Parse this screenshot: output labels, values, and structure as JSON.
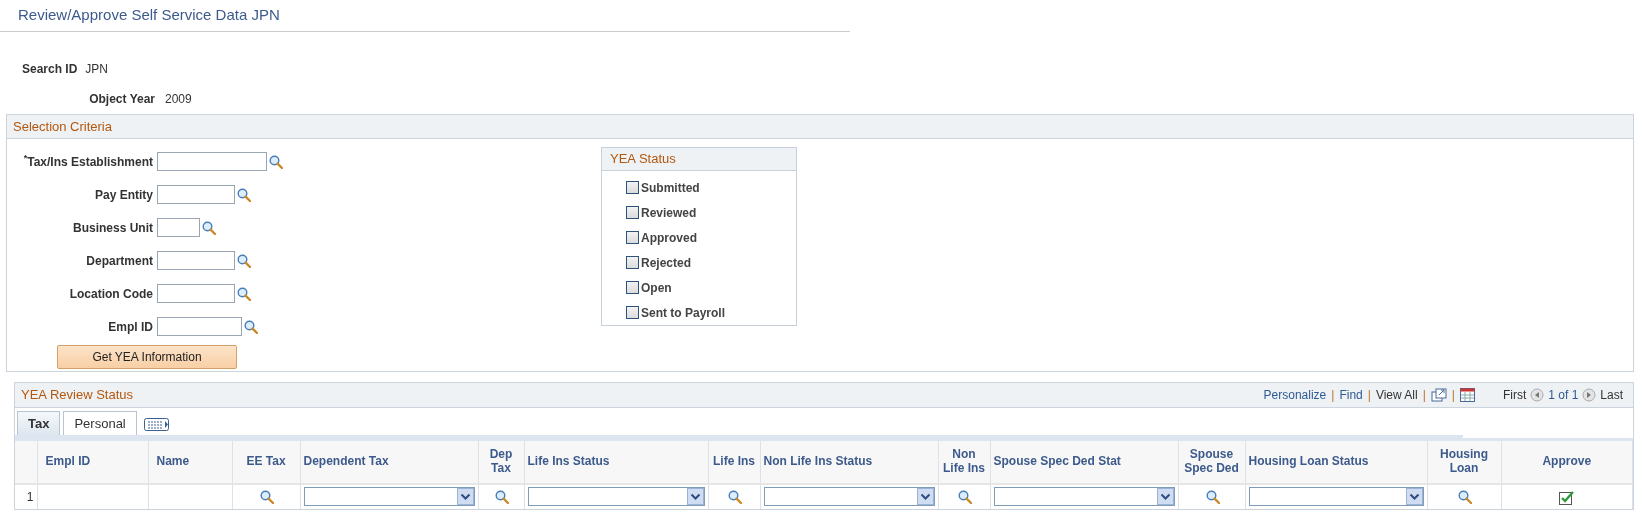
{
  "page_title": "Review/Approve Self Service Data JPN",
  "search_id": {
    "label": "Search ID",
    "value": "JPN"
  },
  "object_year": {
    "label": "Object Year",
    "value": "2009"
  },
  "selection_criteria": {
    "title": "Selection Criteria",
    "fields": [
      {
        "label": "$^{*}$Tax/Ins Establishment"
      },
      {
        "label": "Pay Entity"
      },
      {
        "label": "Business Unit"
      },
      {
        "label": "Department"
      },
      {
        "label": "Location Code"
      },
      {
        "label": "Empl ID"
      }
    ],
    "button": "Get YEA Information"
  },
  "yea_status": {
    "title": "YEA Status",
    "options": [
      {
        "label": "Submitted",
        "checked": false
      },
      {
        "label": "Reviewed",
        "checked": false
      },
      {
        "label": "Approved",
        "checked": false
      },
      {
        "label": "Rejected",
        "checked": false
      },
      {
        "label": "Open",
        "checked": false
      },
      {
        "label": "Sent to Payroll",
        "checked": false
      }
    ]
  },
  "review_status": {
    "title": "YEA Review Status",
    "toolbar": [
      {
        "kind": "link",
        "label": "Personalize"
      },
      {
        "kind": "separator",
        "label": "|"
      },
      {
        "kind": "link",
        "label": "Find"
      },
      {
        "kind": "separator",
        "label": "|"
      },
      {
        "kind": "plain_link",
        "label": "View All"
      },
      {
        "kind": "separator",
        "label": "|"
      },
      {
        "kind": "new_window"
      },
      {
        "kind": "separator",
        "label": "|"
      },
      {
        "kind": "spreadsheet"
      }
    ],
    "pager": {
      "first": "First",
      "count": "1 of 1",
      "last": "Last"
    },
    "tabs": [
      {
        "label": "Tax",
        "selected": true
      },
      {
        "label": "Personal",
        "selected": false
      }
    ],
    "columns": [
      {
        "label": "Empl ID",
        "kind": "text"
      },
      {
        "label": "Name",
        "kind": "text"
      },
      {
        "label": "EE Tax",
        "kind": "lookup"
      },
      {
        "label": "Dependent Tax",
        "kind": "select"
      },
      {
        "label": "Dep Tax",
        "kind": "lookup"
      },
      {
        "label": "Life Ins Status",
        "kind": "select"
      },
      {
        "label": "Life Ins",
        "kind": "lookup"
      },
      {
        "label": "Non Life Ins Status",
        "kind": "select"
      },
      {
        "label": "Non Life Ins",
        "kind": "lookup"
      },
      {
        "label": "Spouse Spec Ded Stat",
        "kind": "select"
      },
      {
        "label": "Spouse Spec Ded",
        "kind": "lookup"
      },
      {
        "label": "Housing Loan Status",
        "kind": "select"
      },
      {
        "label": "Housing Loan",
        "kind": "lookup"
      },
      {
        "label": "Approve",
        "kind": "check"
      }
    ],
    "rows": [
      {
        "number": "1",
        "approved": true
      }
    ]
  }
}
